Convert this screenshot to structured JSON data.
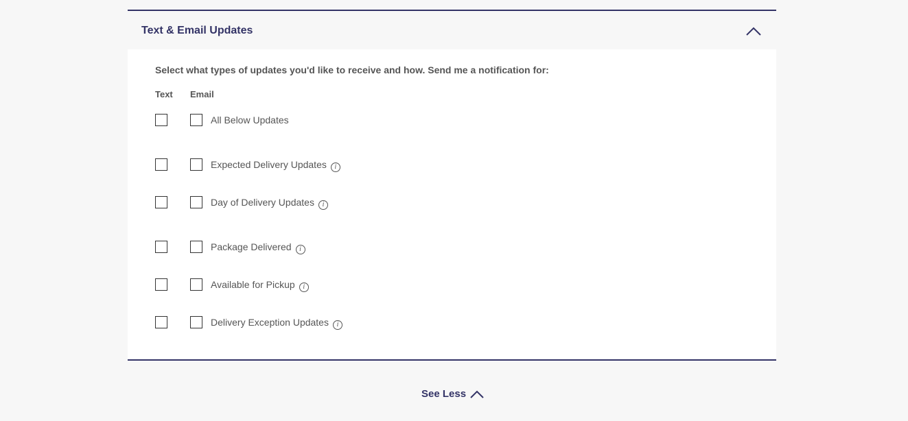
{
  "section": {
    "title": "Text & Email Updates",
    "collapse_icon": "chevron-up-icon"
  },
  "intro": "Select what types of updates you'd like to receive and how. Send me a notification for:",
  "columns": {
    "text": "Text",
    "email": "Email"
  },
  "options": [
    {
      "label": "All Below Updates",
      "info": false,
      "text_checked": false,
      "email_checked": false
    },
    {
      "label": "Expected Delivery Updates",
      "info": true,
      "text_checked": false,
      "email_checked": false
    },
    {
      "label": "Day of Delivery Updates",
      "info": true,
      "text_checked": false,
      "email_checked": false
    },
    {
      "label": "Package Delivered",
      "info": true,
      "text_checked": false,
      "email_checked": false
    },
    {
      "label": "Available for Pickup",
      "info": true,
      "text_checked": false,
      "email_checked": false
    },
    {
      "label": "Delivery Exception Updates",
      "info": true,
      "text_checked": false,
      "email_checked": false
    }
  ],
  "footer": {
    "see_less": "See Less",
    "see_less_icon": "chevron-up-icon"
  },
  "colors": {
    "accent": "#333366",
    "text": "#555555",
    "background": "#f7f7f7"
  }
}
